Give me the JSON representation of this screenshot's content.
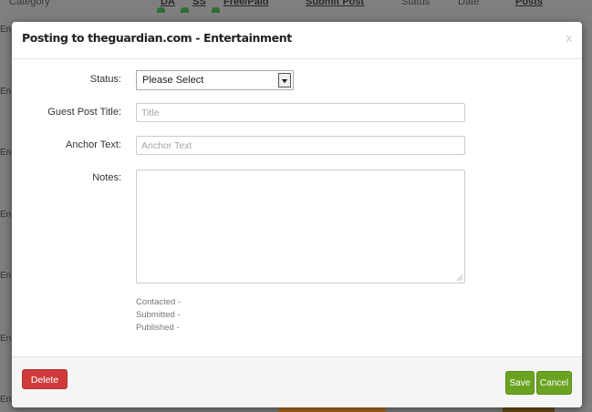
{
  "background": {
    "columns": {
      "category": "Category",
      "da": "DA",
      "ss": "SS",
      "free_paid": "Free/Paid",
      "submit_post": "Submit Post",
      "status": "Status",
      "date": "Date",
      "posts": "Posts"
    },
    "row_labels": [
      "En",
      "En",
      "En",
      "En",
      "En",
      "En",
      "En"
    ]
  },
  "modal": {
    "title": "Posting to theguardian.com - Entertainment",
    "close": "x",
    "fields": {
      "status": {
        "label": "Status:",
        "value": "Please Select"
      },
      "guest_post_title": {
        "label": "Guest Post Title:",
        "placeholder": "Title",
        "value": ""
      },
      "anchor_text": {
        "label": "Anchor Text:",
        "placeholder": "Anchor Text",
        "value": ""
      },
      "notes": {
        "label": "Notes:",
        "value": ""
      }
    },
    "meta": {
      "contacted": "Contacted -",
      "submitted": "Submitted -",
      "published": "Published -"
    },
    "footer": {
      "delete_label": "Delete",
      "save_label": "Save",
      "cancel_label": "Cancel"
    }
  },
  "colors": {
    "overlay": "#7f7f7f",
    "delete": "#cf3b3b",
    "save": "#6aa322",
    "cancel": "#6aa322"
  },
  "icons": [
    "close-icon",
    "chevron-down-icon",
    "resize-grip-icon"
  ]
}
